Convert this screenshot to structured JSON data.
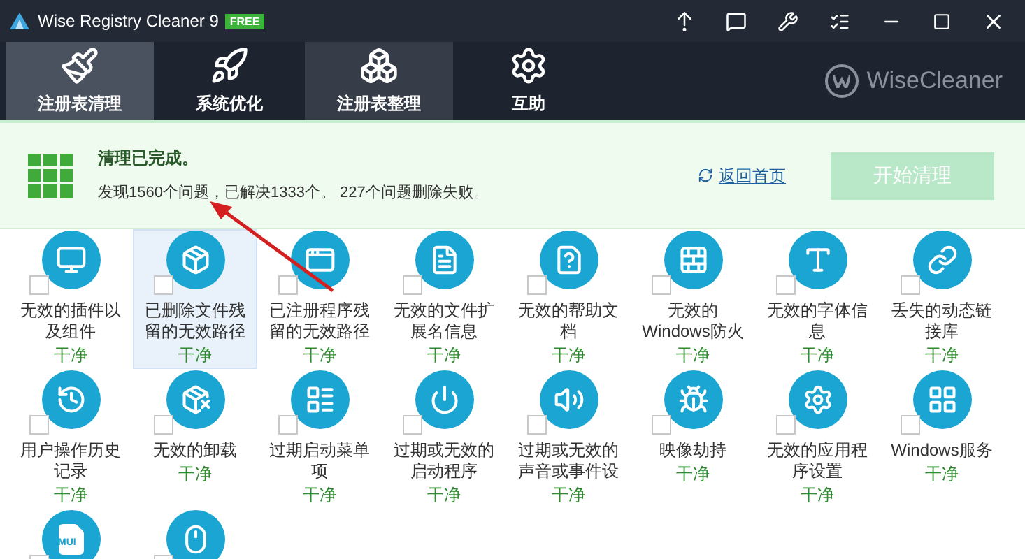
{
  "window": {
    "title": "Wise Registry Cleaner 9",
    "edition_badge": "FREE"
  },
  "tabs": [
    {
      "label": "注册表清理",
      "selected": true,
      "hovered": false
    },
    {
      "label": "系统优化",
      "selected": false,
      "hovered": false
    },
    {
      "label": "注册表整理",
      "selected": false,
      "hovered": true
    },
    {
      "label": "互助",
      "selected": false,
      "hovered": false
    }
  ],
  "brand": "WiseCleaner",
  "summary": {
    "title": "清理已完成。",
    "detail": "发现1560个问题，已解决1333个。 227个问题删除失败。",
    "back_link": "返回首页",
    "start_button": {
      "label": "开始清理",
      "disabled": true
    }
  },
  "items": [
    {
      "label": "无效的插件以及组件",
      "status": "干净",
      "selected": false,
      "checked": false
    },
    {
      "label": "已删除文件残留的无效路径",
      "status": "干净",
      "selected": true,
      "checked": false
    },
    {
      "label": "已注册程序残留的无效路径",
      "status": "干净",
      "selected": false,
      "checked": false
    },
    {
      "label": "无效的文件扩展名信息",
      "status": "干净",
      "selected": false,
      "checked": false
    },
    {
      "label": "无效的帮助文档",
      "status": "干净",
      "selected": false,
      "checked": false
    },
    {
      "label": "无效的Windows防火",
      "status": "干净",
      "selected": false,
      "checked": false
    },
    {
      "label": "无效的字体信息",
      "status": "干净",
      "selected": false,
      "checked": false
    },
    {
      "label": "丢失的动态链接库",
      "status": "干净",
      "selected": false,
      "checked": false
    },
    {
      "label": "用户操作历史记录",
      "status": "干净",
      "selected": false,
      "checked": false
    },
    {
      "label": "无效的卸载",
      "status": "干净",
      "selected": false,
      "checked": false
    },
    {
      "label": "过期启动菜单项",
      "status": "干净",
      "selected": false,
      "checked": false
    },
    {
      "label": "过期或无效的启动程序",
      "status": "干净",
      "selected": false,
      "checked": false
    },
    {
      "label": "过期或无效的声音或事件设",
      "status": "干净",
      "selected": false,
      "checked": false
    },
    {
      "label": "映像劫持",
      "status": "干净",
      "selected": false,
      "checked": false
    },
    {
      "label": "无效的应用程序设置",
      "status": "干净",
      "selected": false,
      "checked": false
    },
    {
      "label": "Windows服务",
      "status": "干净",
      "selected": false,
      "checked": false
    },
    {
      "icon_text": "MUI",
      "selected": false,
      "checked": false
    },
    {
      "selected": false,
      "checked": false
    }
  ]
}
